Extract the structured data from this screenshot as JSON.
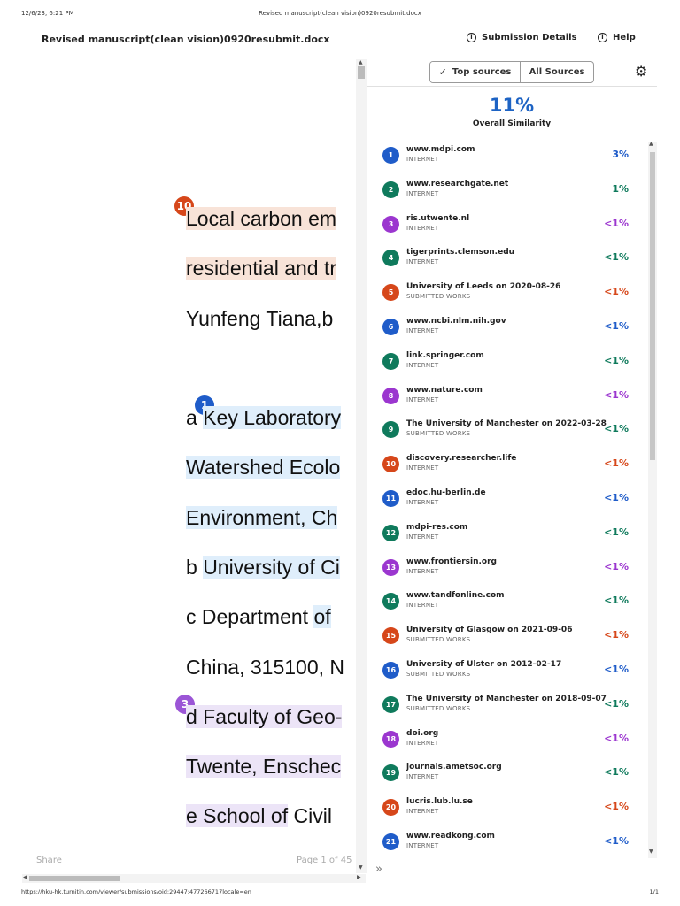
{
  "print": {
    "datetime": "12/6/23, 6:21 PM",
    "title": "Revised manuscript(clean vision)0920resubmit.docx",
    "url": "https://hku-hk.turnitin.com/viewer/submissions/oid:29447:477266717locale=en",
    "page": "1/1"
  },
  "header": {
    "doc_title": "Revised manuscript(clean vision)0920resubmit.docx",
    "submission_details": "Submission Details",
    "help": "Help"
  },
  "document": {
    "markers": {
      "m10": "10",
      "m1": "1",
      "m3": "3"
    },
    "lines": {
      "l1": "Local carbon em",
      "l2": "residential and tr",
      "l3": "Yunfeng Tiana,b",
      "l4a": "a ",
      "l4b": "Key Laboratory",
      "l5": "Watershed Ecolo",
      "l6": "Environment, Ch",
      "l7a": "b ",
      "l7b": "University of Ci",
      "l8a": "c Department ",
      "l8b": "of ",
      "l9": "China, 315100, N",
      "l10": "d Faculty of Geo-",
      "l11": "Twente, Enschec",
      "l12a": "e School of",
      "l12b": " Civil "
    },
    "share": "Share",
    "page_indicator": "Page 1 of 45"
  },
  "panel": {
    "tab_top": "Top sources",
    "tab_all": "All Sources",
    "overall_pct": "11%",
    "overall_label": "Overall Similarity",
    "expand_icon": "double-chevron-right"
  },
  "colors": {
    "blue": "#1f5cc9",
    "green": "#0f7a5c",
    "purple": "#9b36cf",
    "orange": "#d6471a",
    "accent": "#1d63c4"
  },
  "sources": [
    {
      "num": "1",
      "name": "www.mdpi.com",
      "type": "INTERNET",
      "pct": "3%",
      "color": "#1f5cc9"
    },
    {
      "num": "2",
      "name": "www.researchgate.net",
      "type": "INTERNET",
      "pct": "1%",
      "color": "#0f7a5c"
    },
    {
      "num": "3",
      "name": "ris.utwente.nl",
      "type": "INTERNET",
      "pct": "<1%",
      "color": "#9b36cf"
    },
    {
      "num": "4",
      "name": "tigerprints.clemson.edu",
      "type": "INTERNET",
      "pct": "<1%",
      "color": "#0f7a5c"
    },
    {
      "num": "5",
      "name": "University of Leeds on 2020-08-26",
      "type": "SUBMITTED WORKS",
      "pct": "<1%",
      "color": "#d6471a"
    },
    {
      "num": "6",
      "name": "www.ncbi.nlm.nih.gov",
      "type": "INTERNET",
      "pct": "<1%",
      "color": "#1f5cc9"
    },
    {
      "num": "7",
      "name": "link.springer.com",
      "type": "INTERNET",
      "pct": "<1%",
      "color": "#0f7a5c"
    },
    {
      "num": "8",
      "name": "www.nature.com",
      "type": "INTERNET",
      "pct": "<1%",
      "color": "#9b36cf"
    },
    {
      "num": "9",
      "name": "The University of Manchester on 2022-03-28",
      "type": "SUBMITTED WORKS",
      "pct": "<1%",
      "color": "#0f7a5c"
    },
    {
      "num": "10",
      "name": "discovery.researcher.life",
      "type": "INTERNET",
      "pct": "<1%",
      "color": "#d6471a"
    },
    {
      "num": "11",
      "name": "edoc.hu-berlin.de",
      "type": "INTERNET",
      "pct": "<1%",
      "color": "#1f5cc9"
    },
    {
      "num": "12",
      "name": "mdpi-res.com",
      "type": "INTERNET",
      "pct": "<1%",
      "color": "#0f7a5c"
    },
    {
      "num": "13",
      "name": "www.frontiersin.org",
      "type": "INTERNET",
      "pct": "<1%",
      "color": "#9b36cf"
    },
    {
      "num": "14",
      "name": "www.tandfonline.com",
      "type": "INTERNET",
      "pct": "<1%",
      "color": "#0f7a5c"
    },
    {
      "num": "15",
      "name": "University of Glasgow on 2021-09-06",
      "type": "SUBMITTED WORKS",
      "pct": "<1%",
      "color": "#d6471a"
    },
    {
      "num": "16",
      "name": "University of Ulster on 2012-02-17",
      "type": "SUBMITTED WORKS",
      "pct": "<1%",
      "color": "#1f5cc9"
    },
    {
      "num": "17",
      "name": "The University of Manchester on 2018-09-07",
      "type": "SUBMITTED WORKS",
      "pct": "<1%",
      "color": "#0f7a5c"
    },
    {
      "num": "18",
      "name": "doi.org",
      "type": "INTERNET",
      "pct": "<1%",
      "color": "#9b36cf"
    },
    {
      "num": "19",
      "name": "journals.ametsoc.org",
      "type": "INTERNET",
      "pct": "<1%",
      "color": "#0f7a5c"
    },
    {
      "num": "20",
      "name": "lucris.lub.lu.se",
      "type": "INTERNET",
      "pct": "<1%",
      "color": "#d6471a"
    },
    {
      "num": "21",
      "name": "www.readkong.com",
      "type": "INTERNET",
      "pct": "<1%",
      "color": "#1f5cc9"
    }
  ]
}
